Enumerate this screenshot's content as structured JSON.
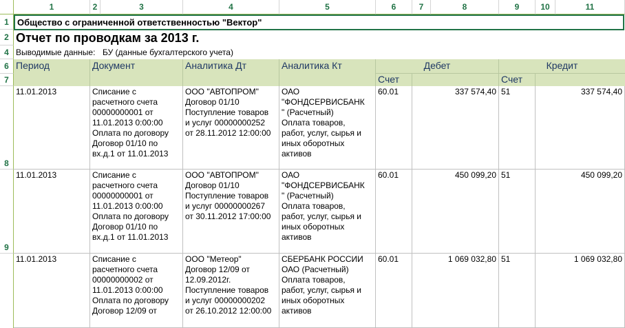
{
  "column_headers": [
    "1",
    "2",
    "3",
    "4",
    "5",
    "6",
    "7",
    "8",
    "9",
    "10",
    "11"
  ],
  "row_numbers": [
    "1",
    "2",
    "4",
    "6",
    "7",
    "8",
    "9"
  ],
  "company": "Общество с ограниченной ответственностью \"Вектор\"",
  "report_title": "Отчет по проводкам за 2013 г.",
  "output_label": "Выводимые данные:",
  "output_value": "БУ (данные бухгалтерского учета)",
  "header": {
    "period": "Период",
    "document": "Документ",
    "analytics_dt": "Аналитика Дт",
    "analytics_kt": "Аналитика Кт",
    "debit": "Дебет",
    "credit": "Кредит",
    "account_dt": "Счет",
    "account_kt": "Счет"
  },
  "rows": [
    {
      "period": "11.01.2013",
      "document": [
        "Списание с",
        "расчетного счета",
        "00000000001 от",
        "11.01.2013 0:00:00",
        "Оплата по договору",
        "Договор 01/10 по",
        "вх.д.1 от 11.01.2013"
      ],
      "analytics_dt": [
        "ООО \"АВТОПРОМ\"",
        "Договор 01/10",
        "Поступление товаров",
        "и услуг 00000000252",
        "от 28.11.2012 12:00:00"
      ],
      "analytics_kt": [
        "ОАО",
        "\"ФОНДСЕРВИСБАНК",
        "\" (Расчетный)",
        "Оплата товаров,",
        "работ, услуг, сырья и",
        "иных оборотных",
        "активов"
      ],
      "account_dt": "60.01",
      "debit": "337 574,40",
      "account_kt": "51",
      "credit": "337 574,40"
    },
    {
      "period": "11.01.2013",
      "document": [
        "Списание с",
        "расчетного счета",
        "00000000001 от",
        "11.01.2013 0:00:00",
        "Оплата по договору",
        "Договор 01/10 по",
        "вх.д.1 от 11.01.2013"
      ],
      "analytics_dt": [
        "ООО \"АВТОПРОМ\"",
        "Договор 01/10",
        "Поступление товаров",
        "и услуг 00000000267",
        "от 30.11.2012 17:00:00"
      ],
      "analytics_kt": [
        "ОАО",
        "\"ФОНДСЕРВИСБАНК",
        "\" (Расчетный)",
        "Оплата товаров,",
        "работ, услуг, сырья и",
        "иных оборотных",
        "активов"
      ],
      "account_dt": "60.01",
      "debit": "450 099,20",
      "account_kt": "51",
      "credit": "450 099,20"
    },
    {
      "period": "11.01.2013",
      "document": [
        "Списание с",
        "расчетного счета",
        "00000000002 от",
        "11.01.2013 0:00:00",
        "Оплата по договору",
        "Договор 12/09 от"
      ],
      "analytics_dt": [
        "ООО \"Метеор\"",
        "Договор 12/09 от",
        "12.09.2012г.",
        "Поступление товаров",
        "и услуг 00000000202",
        "от 26.10.2012 12:00:00"
      ],
      "analytics_kt": [
        "СБЕРБАНК РОССИИ",
        "ОАО (Расчетный)",
        "Оплата товаров,",
        "работ, услуг, сырья и",
        "иных оборотных",
        "активов"
      ],
      "account_dt": "60.01",
      "debit": "1 069 032,80",
      "account_kt": "51",
      "credit": "1 069 032,80"
    }
  ],
  "colors": {
    "header_fill": "#d8e4bc",
    "header_text": "#1f3864",
    "selection": "#217346"
  }
}
